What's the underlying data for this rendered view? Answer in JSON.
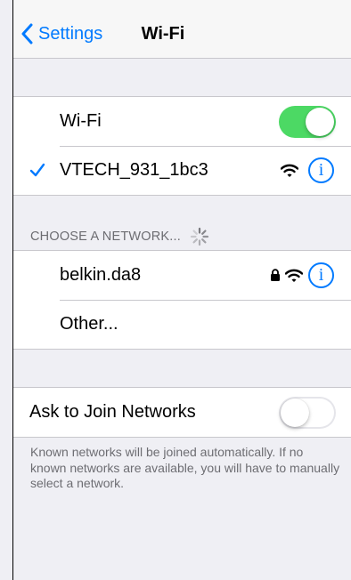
{
  "navbar": {
    "back_label": "Settings",
    "title": "Wi-Fi"
  },
  "wifi_toggle": {
    "label": "Wi-Fi",
    "state": "on"
  },
  "connected_network": {
    "name": "VTECH_931_1bc3",
    "selected": true,
    "secured": false,
    "info_label": "i"
  },
  "choose_network": {
    "header": "CHOOSE A NETWORK...",
    "networks": [
      {
        "name": "belkin.da8",
        "secured": true,
        "info_label": "i"
      }
    ],
    "other_label": "Other..."
  },
  "ask_to_join": {
    "label": "Ask to Join Networks",
    "state": "off",
    "footer": "Known networks will be joined automatically. If no known networks are available, you will have to manually select a network."
  },
  "colors": {
    "accent": "#007aff",
    "toggle_on": "#4cd964",
    "background": "#efeff4",
    "secondary_text": "#6d6d72"
  },
  "icons": [
    "chevron-left-icon",
    "checkmark-icon",
    "wifi-icon",
    "lock-icon",
    "info-icon",
    "spinner-icon"
  ]
}
